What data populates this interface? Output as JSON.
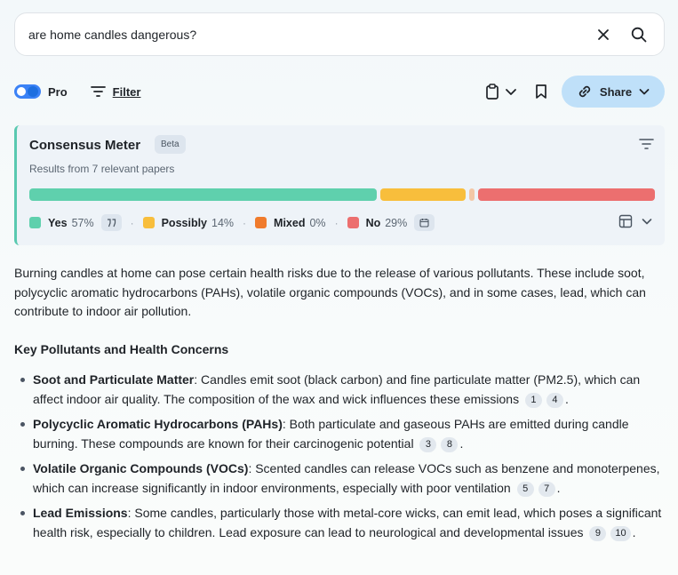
{
  "search": {
    "query": "are home candles dangerous?"
  },
  "toolbar": {
    "pro_label": "Pro",
    "filter_label": "Filter",
    "share_label": "Share"
  },
  "meter": {
    "title": "Consensus Meter",
    "badge": "Beta",
    "subtitle": "Results from 7 relevant papers",
    "segments": [
      {
        "name": "Yes",
        "pct_label": "57%",
        "value": 57,
        "color": "#5fd0ad"
      },
      {
        "name": "Possibly",
        "pct_label": "14%",
        "value": 14,
        "color": "#f8be3c"
      },
      {
        "name": "Mixed",
        "pct_label": "0%",
        "value": 0,
        "color": "#f07b2c"
      },
      {
        "name": "No",
        "pct_label": "29%",
        "value": 29,
        "color": "#ec6f6f"
      }
    ]
  },
  "intro": "Burning candles at home can pose certain health risks due to the release of various pollutants. These include soot, polycyclic aromatic hydrocarbons (PAHs), volatile organic compounds (VOCs), and in some cases, lead, which can contribute to indoor air pollution.",
  "section_title": "Key Pollutants and Health Concerns",
  "points": [
    {
      "title": "Soot and Particulate Matter",
      "text": ": Candles emit soot (black carbon) and fine particulate matter (PM2.5), which can affect indoor air quality. The composition of the wax and wick influences these emissions",
      "cites": [
        "1",
        "4"
      ]
    },
    {
      "title": "Polycyclic Aromatic Hydrocarbons (PAHs)",
      "text": ": Both particulate and gaseous PAHs are emitted during candle burning. These compounds are known for their carcinogenic potential",
      "cites": [
        "3",
        "8"
      ]
    },
    {
      "title": "Volatile Organic Compounds (VOCs)",
      "text": ": Scented candles can release VOCs such as benzene and monoterpenes, which can increase significantly in indoor environments, especially with poor ventilation",
      "cites": [
        "5",
        "7"
      ]
    },
    {
      "title": "Lead Emissions",
      "text": ": Some candles, particularly those with metal-core wicks, can emit lead, which poses a significant health risk, especially to children. Lead exposure can lead to neurological and developmental issues",
      "cites": [
        "9",
        "10"
      ]
    }
  ]
}
